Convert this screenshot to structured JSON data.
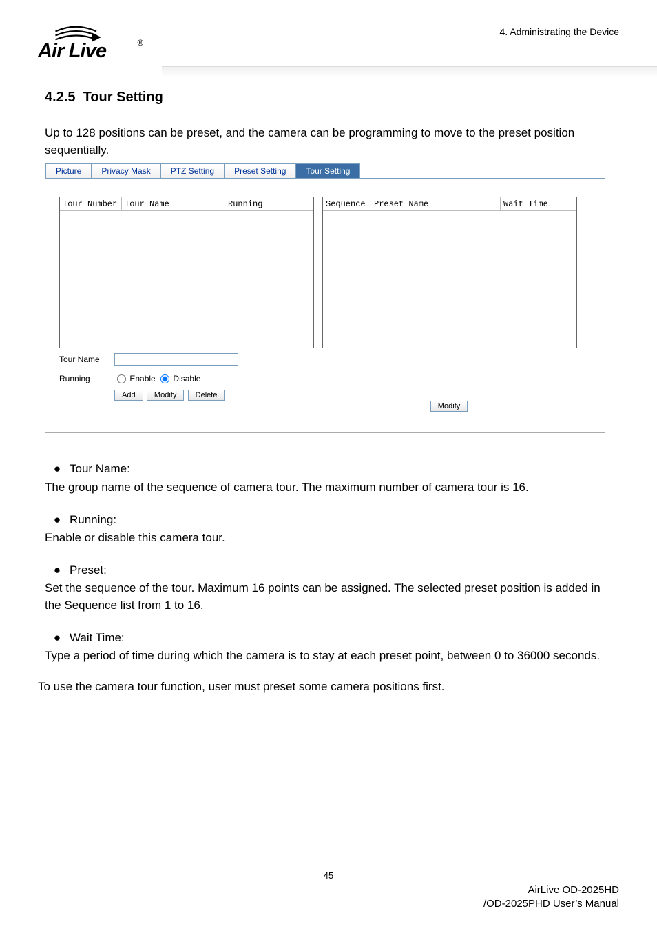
{
  "header": {
    "page_section": "4. Administrating the Device",
    "logo_alt": "Air Live"
  },
  "section": {
    "number": "4.2.5",
    "title": "Tour Setting",
    "intro": "Up to 128 positions can be preset, and the camera can be programming to move to the preset position sequentially."
  },
  "screenshot": {
    "tabs": {
      "picture": "Picture",
      "privacy": "Privacy Mask",
      "ptz": "PTZ Setting",
      "preset": "Preset Setting",
      "tour": "Tour Setting"
    },
    "left_grid": {
      "col1": "Tour Number",
      "col2": "Tour Name",
      "col3": "Running"
    },
    "right_grid": {
      "col1": "Sequence",
      "col2": "Preset Name",
      "col3": "Wait Time"
    },
    "form": {
      "tour_name_label": "Tour Name",
      "tour_name_value": "",
      "running_label": "Running",
      "enable": "Enable",
      "disable": "Disable",
      "running_value": "disable"
    },
    "buttons": {
      "add": "Add",
      "modify": "Modify",
      "delete": "Delete",
      "modify_r": "Modify"
    }
  },
  "items": {
    "tour_name": {
      "label": "Tour Name:",
      "desc": "The group name of the sequence of camera tour. The maximum number of camera tour is 16."
    },
    "running": {
      "label": "Running:",
      "desc": "Enable or disable this camera tour."
    },
    "preset": {
      "label": "Preset:",
      "desc": "Set the sequence of the tour. Maximum 16 points can be assigned. The selected preset position is added in the Sequence list from 1 to 16."
    },
    "wait_time": {
      "label": "Wait Time:",
      "desc": "Type a period of time during which the camera is to stay at each preset point, between 0 to 36000 seconds."
    }
  },
  "closing": "To use the camera tour function, user must preset some camera positions first.",
  "footer": {
    "page": "45",
    "line1": "AirLive OD-2025HD",
    "line2": "/OD-2025PHD User’s Manual"
  }
}
